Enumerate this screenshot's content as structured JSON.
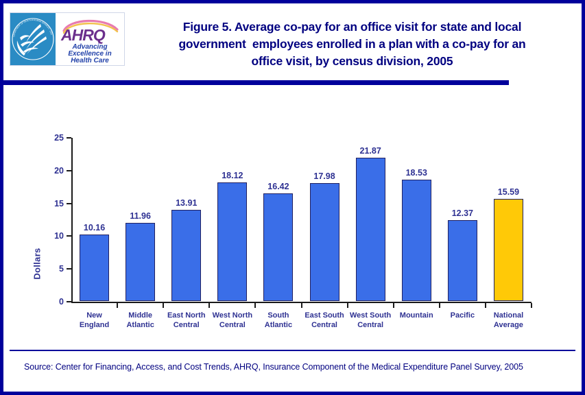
{
  "figure": {
    "title": "Figure 5. Average co-pay for an office visit for state and local\ngovernment  employees enrolled in a plan with a co-pay for an\noffice visit, by census division, 2005",
    "source": "Source: Center for Financing, Access, and Cost Trends, AHRQ, Insurance Component of the Medical Expenditure Panel Survey, 2005"
  },
  "logo": {
    "agency_seal_name": "hhs-seal-icon",
    "brand_acronym": "AHRQ",
    "tagline_line1": "Advancing",
    "tagline_line2": "Excellence in",
    "tagline_line3": "Health Care",
    "seal_ring_text": "DEPARTMENT OF HEALTH & HUMAN SERVICES · USA"
  },
  "colors": {
    "frame_blue": "#00009B",
    "title_blue": "#000080",
    "label_blue": "#2E3192",
    "bar_blue": "#3A6EE8",
    "bar_gold": "#FFC907",
    "bar_outline": "#202060",
    "seal_blue": "#2a8bc4",
    "ahrq_purple": "#6B2F8C"
  },
  "chart_data": {
    "type": "bar",
    "title": "Figure 5. Average co-pay for an office visit for state and local government  employees enrolled in a plan with a co-pay for an office visit, by census division, 2005",
    "xlabel": "",
    "ylabel": "Dollars",
    "ylim": [
      0,
      25
    ],
    "yticks": [
      0,
      5,
      10,
      15,
      20,
      25
    ],
    "ytick_labels": [
      "0",
      "5",
      "10",
      "15",
      "20",
      "25"
    ],
    "grid": false,
    "legend": null,
    "categories": [
      "New\nEngland",
      "Middle\nAtlantic",
      "East North\nCentral",
      "West North\nCentral",
      "South\nAtlantic",
      "East South\nCentral",
      "West South\nCentral",
      "Mountain",
      "Pacific",
      "National\nAverage"
    ],
    "values": [
      10.16,
      11.96,
      13.91,
      18.12,
      16.42,
      17.98,
      21.87,
      18.53,
      12.37,
      15.59
    ],
    "value_labels": [
      "10.16",
      "11.96",
      "13.91",
      "18.12",
      "16.42",
      "17.98",
      "21.87",
      "18.53",
      "12.37",
      "15.59"
    ],
    "bar_colors": [
      "#3A6EE8",
      "#3A6EE8",
      "#3A6EE8",
      "#3A6EE8",
      "#3A6EE8",
      "#3A6EE8",
      "#3A6EE8",
      "#3A6EE8",
      "#3A6EE8",
      "#FFC907"
    ]
  }
}
